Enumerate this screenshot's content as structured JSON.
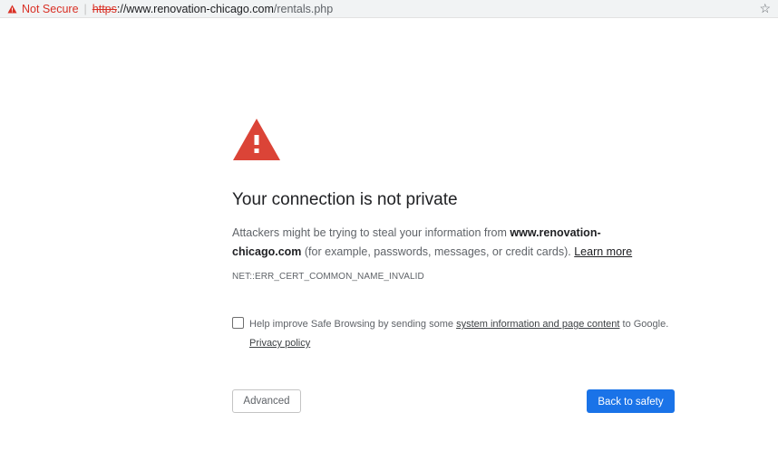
{
  "browser": {
    "not_secure_label": "Not Secure",
    "url_scheme": "https",
    "url_host": "://www.renovation-chicago.com",
    "url_path": "/rentals.php",
    "bookmark_icon": "star-icon"
  },
  "interstitial": {
    "warning_icon": "warning-triangle-icon",
    "heading": "Your connection is not private",
    "body_intro": "Attackers might be trying to steal your information from ",
    "body_host": "www.renovation-chicago.com",
    "body_tail": " (for example, passwords, messages, or credit cards). ",
    "learn_more": "Learn more",
    "error_code": "NET::ERR_CERT_COMMON_NAME_INVALID",
    "optin_intro": "Help improve Safe Browsing by sending some ",
    "optin_link": "system information and page content",
    "optin_tail": " to Google.",
    "privacy_policy": "Privacy policy",
    "optin_checked": false,
    "advanced_label": "Advanced",
    "back_label": "Back to safety"
  },
  "colors": {
    "danger": "#d93025",
    "primary": "#1a73e8",
    "warning_icon": "#db4437"
  }
}
